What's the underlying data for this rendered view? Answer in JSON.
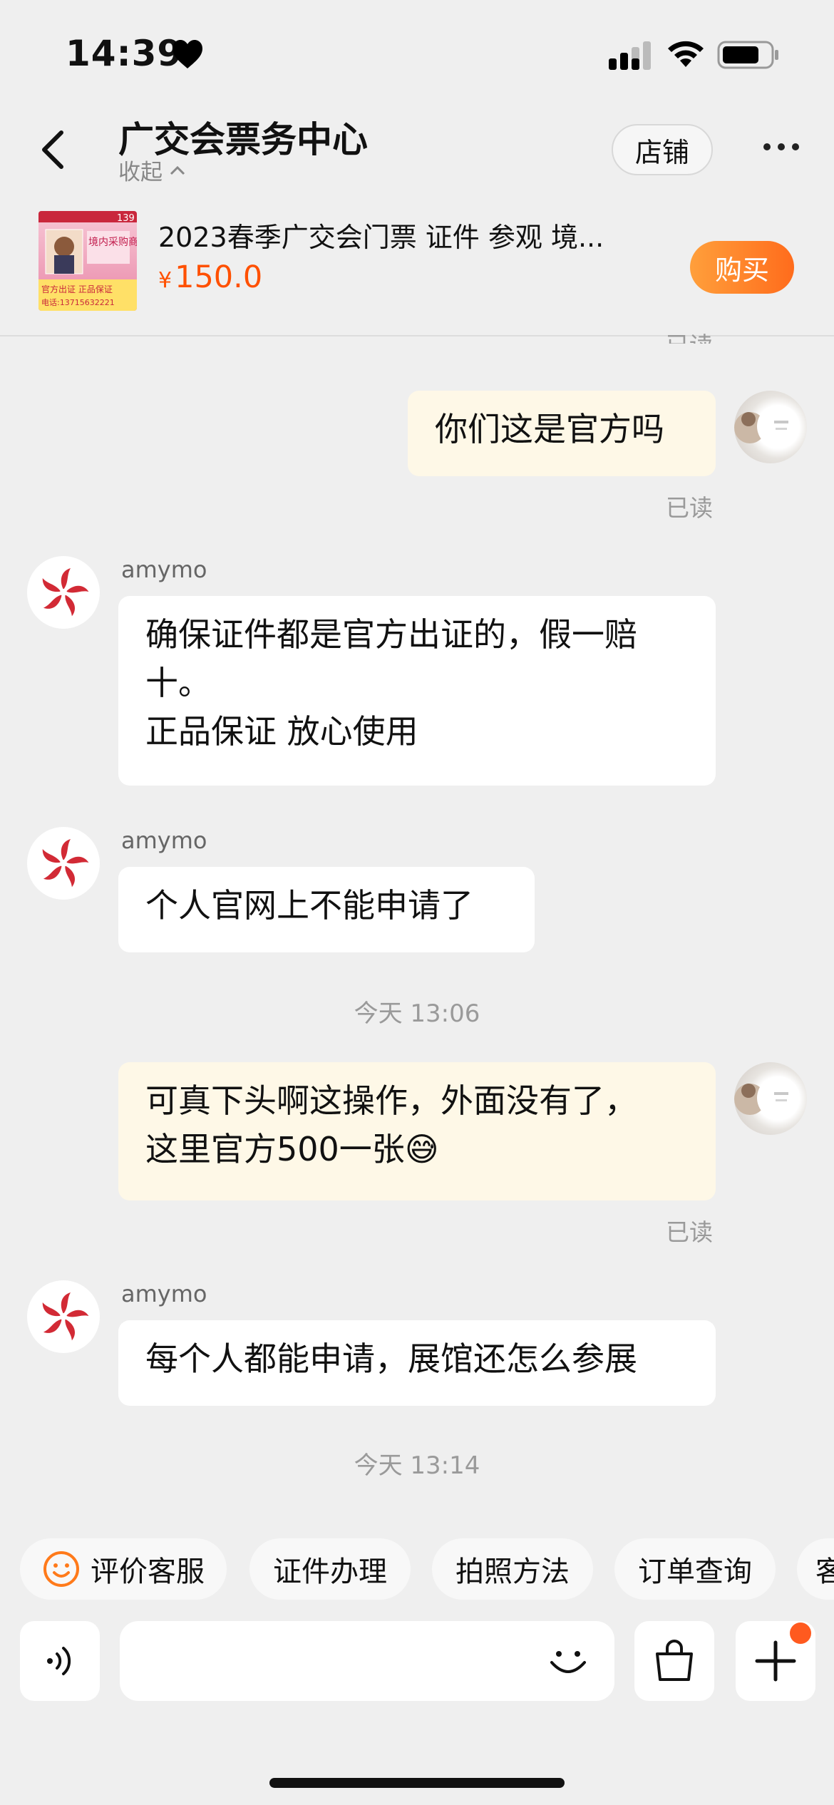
{
  "status": {
    "time": "14:39"
  },
  "header": {
    "title": "广交会票务中心",
    "collapse_label": "收起",
    "store_label": "店铺"
  },
  "product": {
    "name": "2023春季广交会门票 证件 参观 境...",
    "currency": "¥",
    "price": "150.0",
    "buy_label": "购买",
    "thumb_text_top": "139",
    "thumb_badge": "境内采购商",
    "thumb_line1": "官方出证 正品保证",
    "thumb_line2": "电话:13715632221"
  },
  "chat": {
    "read_label": "已读",
    "seller_name": "amymo",
    "msg1": "你们这是官方吗",
    "msg2_line1": "确保证件都是官方出证的，假一赔",
    "msg2_line2": "十。",
    "msg2_line3": "正品保证 放心使用",
    "msg3": "个人官网上不能申请了",
    "time1": "今天 13:06",
    "msg4_line1": "可真下头啊这操作，外面没有了，",
    "msg4_line2": "这里官方500一张😅",
    "msg5": "每个人都能申请，展馆还怎么参展",
    "time2": "今天 13:14"
  },
  "quick_replies": [
    "评价客服",
    "证件办理",
    "拍照方法",
    "订单查询",
    "客"
  ],
  "input": {
    "placeholder": ""
  },
  "colors": {
    "accent": "#ff5000",
    "my_bubble": "#fef8e7",
    "buy_gradient_start": "#ff9f3b",
    "buy_gradient_end": "#ff6c1c"
  }
}
